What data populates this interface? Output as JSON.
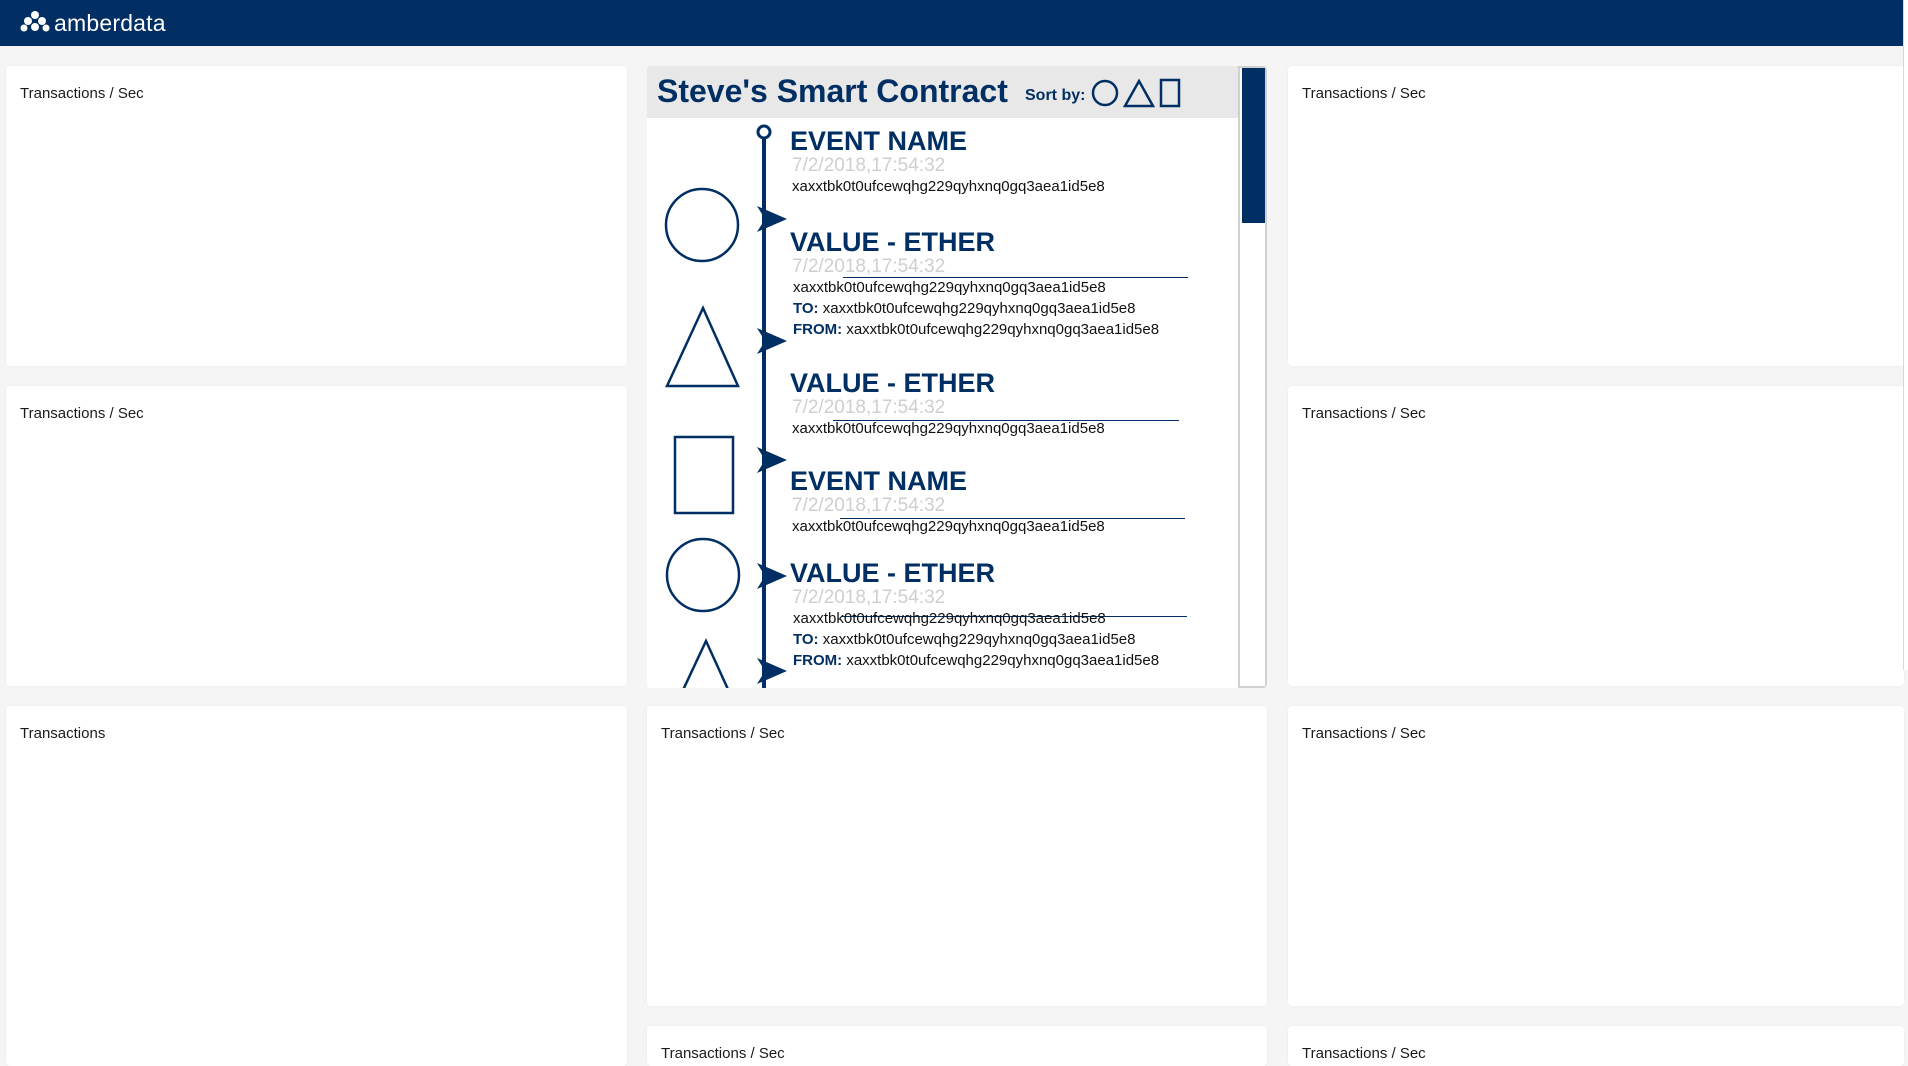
{
  "header": {
    "brand": "amberdata",
    "brand_color": "#012f63"
  },
  "cards": [
    {
      "title": "Transactions / Sec"
    },
    {
      "title": "Transactions / Sec"
    },
    {
      "title": "Transactions / Sec"
    },
    {
      "title": "Transactions / Sec"
    },
    {
      "title": "Transactions"
    },
    {
      "title": "Transactions / Sec"
    },
    {
      "title": "Transactions / Sec"
    },
    {
      "title": "Transactions / Sec"
    },
    {
      "title": "Transactions / Sec"
    }
  ],
  "timeline": {
    "title": "Steve's Smart Contract",
    "sort_label": "Sort by:",
    "sort_options": [
      "circle-icon",
      "triangle-icon",
      "square-icon"
    ],
    "to_label": "TO:",
    "from_label": "FROM:",
    "events": [
      {
        "shape": "circle-icon",
        "name": "EVENT NAME",
        "time": "7/2/2018,17:54:32",
        "hash": "xaxxtbk0t0ufcewqhg229qyhxnq0gq3aea1id5e8"
      },
      {
        "shape": "triangle-icon",
        "name": "VALUE - ETHER",
        "time": "7/2/2018,17:54:32",
        "hash": "xaxxtbk0t0ufcewqhg229qyhxnq0gq3aea1id5e8",
        "to": "xaxxtbk0t0ufcewqhg229qyhxnq0gq3aea1id5e8",
        "from": "xaxxtbk0t0ufcewqhg229qyhxnq0gq3aea1id5e8"
      },
      {
        "shape": "square-icon",
        "name": "VALUE - ETHER",
        "time": "7/2/2018,17:54:32",
        "hash": "xaxxtbk0t0ufcewqhg229qyhxnq0gq3aea1id5e8"
      },
      {
        "shape": "circle-icon",
        "name": "EVENT NAME",
        "time": "7/2/2018,17:54:32",
        "hash": "xaxxtbk0t0ufcewqhg229qyhxnq0gq3aea1id5e8"
      },
      {
        "shape": "triangle-icon",
        "name": "VALUE - ETHER",
        "time": "7/2/2018,17:54:32",
        "hash": "xaxxtbk0t0ufcewqhg229qyhxnq0gq3aea1id5e8",
        "to": "xaxxtbk0t0ufcewqhg229qyhxnq0gq3aea1id5e8",
        "from": "xaxxtbk0t0ufcewqhg229qyhxnq0gq3aea1id5e8"
      }
    ]
  }
}
